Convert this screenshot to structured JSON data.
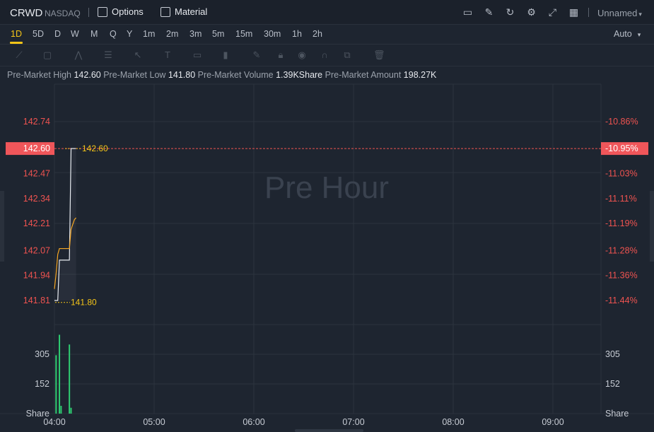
{
  "header": {
    "symbol": "CRWD",
    "exchange": "NASDAQ",
    "options_label": "Options",
    "material_label": "Material",
    "layout_name": "Unnamed",
    "layout_caret": "▾"
  },
  "timeframes": [
    "1D",
    "5D",
    "D",
    "W",
    "M",
    "Q",
    "Y",
    "1m",
    "2m",
    "3m",
    "5m",
    "15m",
    "30m",
    "1h",
    "2h"
  ],
  "active_timeframe": "1D",
  "scale_mode": "Auto",
  "scale_caret": "▾",
  "premarket_stats": {
    "high_label": "Pre-Market High",
    "high_value": "142.60",
    "low_label": "Pre-Market Low",
    "low_value": "141.80",
    "volume_label": "Pre-Market Volume",
    "volume_value": "1.39KShare",
    "amount_label": "Pre-Market Amount",
    "amount_value": "198.27K"
  },
  "watermark": "Pre Hour",
  "colors": {
    "background": "#1e2530",
    "grid": "#2c333e",
    "price_axis": "#ef5350",
    "highlight_bg": "#f0565a",
    "price_line": "#e9edf2",
    "avg_line": "#f5a623",
    "volume_bar": "#2ecc71",
    "accent": "#f5c518"
  },
  "chart_data": {
    "type": "line",
    "session": "pre-market",
    "price_axis_labels": [
      "142.74",
      "142.60",
      "142.47",
      "142.34",
      "142.21",
      "142.07",
      "141.94",
      "141.81"
    ],
    "pct_axis_labels": [
      "-10.86%",
      "-10.95%",
      "-11.03%",
      "-11.11%",
      "-11.19%",
      "-11.28%",
      "-11.36%",
      "-11.44%"
    ],
    "current_price_label": "142.60",
    "current_pct_label": "-10.95%",
    "high_marker": "142.60",
    "low_marker": "141.80",
    "volume_axis_labels": [
      "305",
      "152",
      "Share"
    ],
    "volume_axis_labels_right": [
      "305",
      "152",
      "Share"
    ],
    "x_tick_labels": [
      "04:00",
      "05:00",
      "06:00",
      "07:00",
      "08:00",
      "09:00"
    ],
    "price_series": {
      "name": "price",
      "points": [
        [
          0,
          141.81
        ],
        [
          2,
          141.81
        ],
        [
          3,
          142.02
        ],
        [
          9,
          142.02
        ],
        [
          10,
          142.6
        ],
        [
          13,
          142.6
        ]
      ]
    },
    "avg_series": {
      "name": "avg",
      "points": [
        [
          0,
          141.87
        ],
        [
          1,
          141.95
        ],
        [
          2,
          142.05
        ],
        [
          3,
          142.08
        ],
        [
          9,
          142.08
        ],
        [
          10,
          142.18
        ],
        [
          12,
          142.23
        ],
        [
          13,
          142.24
        ]
      ]
    },
    "volume_bars": [
      {
        "minute": 1,
        "value": 300
      },
      {
        "minute": 3,
        "value": 405
      },
      {
        "minute": 4,
        "value": 40
      },
      {
        "minute": 9,
        "value": 355
      },
      {
        "minute": 10,
        "value": 30
      }
    ],
    "price_ylim": [
      141.81,
      142.74
    ],
    "volume_ylim": [
      0,
      305
    ]
  }
}
